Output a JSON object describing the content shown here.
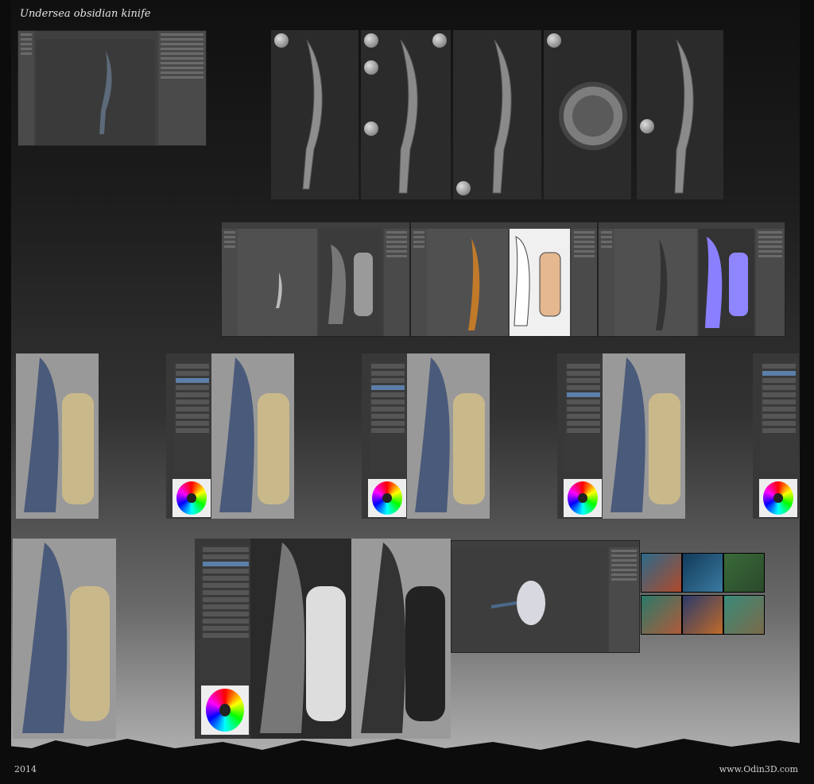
{
  "header": {
    "title": "Undersea obsidian kinife"
  },
  "footer": {
    "year": "2014",
    "website": "www.Odin3D.com"
  },
  "colors": {
    "background": "#0c0c0c",
    "stone": "#9a9a9a",
    "bandage": "#c9b98a",
    "blade_blue": "#4a5a7a",
    "normal_map": "#8080ff"
  },
  "icons": [
    "zbrush-brush-ball-icon",
    "color-wheel-icon"
  ]
}
